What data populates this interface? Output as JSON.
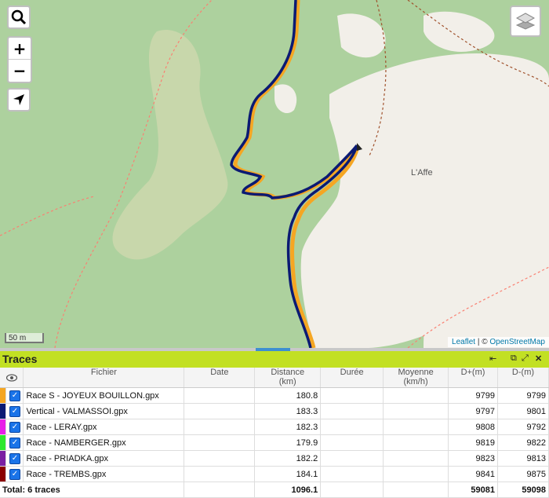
{
  "map": {
    "zoom_in": "+",
    "zoom_out": "−",
    "place_name": "L'Affe",
    "scale_label": "50 m",
    "attribution_leaflet": "Leaflet",
    "attribution_sep": " | © ",
    "attribution_osm": "OpenStreetMap",
    "colors": {
      "forest": "#add19e",
      "open": "#f2efe9",
      "scrub": "#c8d7ab",
      "track1": "#f5a623",
      "track2": "#0b1a73"
    }
  },
  "panel": {
    "title": "Traces",
    "columns": [
      {
        "label": ""
      },
      {
        "label": ""
      },
      {
        "label": "Fichier"
      },
      {
        "label": "Date"
      },
      {
        "label": "Distance",
        "sub": "(km)"
      },
      {
        "label": "Durée"
      },
      {
        "label": "Moyenne",
        "sub": "(km/h)"
      },
      {
        "label": "D+(m)"
      },
      {
        "label": "D-(m)"
      }
    ],
    "rows": [
      {
        "color": "#f5a623",
        "name": "Race S - JOYEUX BOUILLON.gpx",
        "date": "",
        "distance": "180.8",
        "duration": "",
        "avg": "",
        "dplus": "9799",
        "dminus": "9799"
      },
      {
        "color": "#0b1a73",
        "name": "Vertical - VALMASSOI.gpx",
        "date": "",
        "distance": "183.3",
        "duration": "",
        "avg": "",
        "dplus": "9797",
        "dminus": "9801"
      },
      {
        "color": "#e81ee8",
        "name": "Race - LERAY.gpx",
        "date": "",
        "distance": "182.3",
        "duration": "",
        "avg": "",
        "dplus": "9808",
        "dminus": "9792"
      },
      {
        "color": "#2ee82e",
        "name": "Race - NAMBERGER.gpx",
        "date": "",
        "distance": "179.9",
        "duration": "",
        "avg": "",
        "dplus": "9819",
        "dminus": "9822"
      },
      {
        "color": "#7a1fa2",
        "name": "Race - PRIADKA.gpx",
        "date": "",
        "distance": "182.2",
        "duration": "",
        "avg": "",
        "dplus": "9823",
        "dminus": "9813"
      },
      {
        "color": "#8b0000",
        "name": "Race - TREMBS.gpx",
        "date": "",
        "distance": "184.1",
        "duration": "",
        "avg": "",
        "dplus": "9841",
        "dminus": "9875"
      }
    ],
    "total": {
      "label": "Total: 6 traces",
      "distance": "1096.1",
      "dplus": "59081",
      "dminus": "59098"
    }
  }
}
